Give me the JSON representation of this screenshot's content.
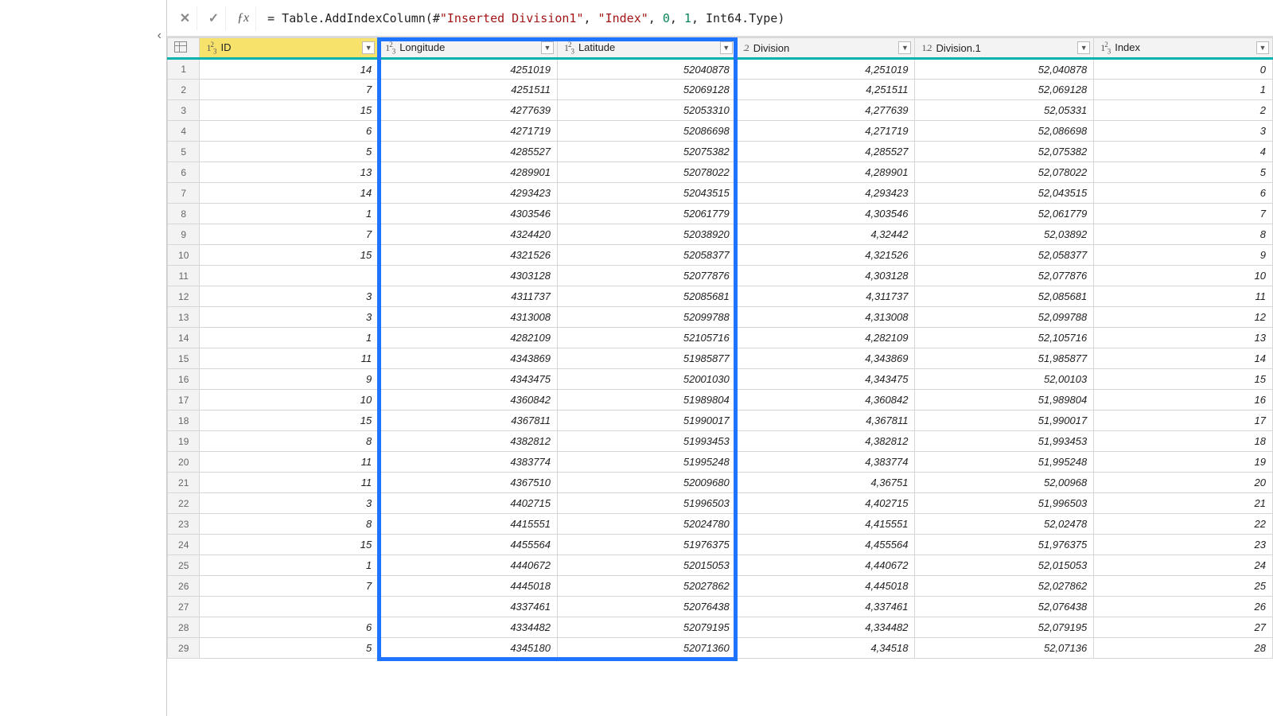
{
  "formula_raw": "= Table.AddIndexColumn(#\"Inserted Division1\", \"Index\", 0, 1, Int64.Type)",
  "columns": [
    {
      "key": "id",
      "name": "ID",
      "type": "123",
      "selected": true,
      "cls": "col-id",
      "dd": true
    },
    {
      "key": "lon",
      "name": "Longitude",
      "type": "123",
      "selected": false,
      "cls": "col-lon",
      "dd": true
    },
    {
      "key": "lat",
      "name": "Latitude",
      "type": "123",
      "selected": false,
      "cls": "col-lat",
      "dd": true
    },
    {
      "key": "div",
      "name": "Division",
      "type": "1.2",
      "selected": false,
      "cls": "col-div",
      "dd": true,
      "prefix": ".2"
    },
    {
      "key": "div1",
      "name": "Division.1",
      "type": "1.2",
      "selected": false,
      "cls": "col-div1",
      "dd": true
    },
    {
      "key": "idx",
      "name": "Index",
      "type": "123",
      "selected": false,
      "cls": "col-idx",
      "dd": true
    }
  ],
  "rows": [
    {
      "n": 1,
      "id": "14",
      "lon": "4251019",
      "lat": "52040878",
      "div": "4,251019",
      "div1": "52,040878",
      "idx": "0"
    },
    {
      "n": 2,
      "id": "7",
      "lon": "4251511",
      "lat": "52069128",
      "div": "4,251511",
      "div1": "52,069128",
      "idx": "1"
    },
    {
      "n": 3,
      "id": "15",
      "lon": "4277639",
      "lat": "52053310",
      "div": "4,277639",
      "div1": "52,05331",
      "idx": "2"
    },
    {
      "n": 4,
      "id": "6",
      "lon": "4271719",
      "lat": "52086698",
      "div": "4,271719",
      "div1": "52,086698",
      "idx": "3"
    },
    {
      "n": 5,
      "id": "5",
      "lon": "4285527",
      "lat": "52075382",
      "div": "4,285527",
      "div1": "52,075382",
      "idx": "4"
    },
    {
      "n": 6,
      "id": "13",
      "lon": "4289901",
      "lat": "52078022",
      "div": "4,289901",
      "div1": "52,078022",
      "idx": "5"
    },
    {
      "n": 7,
      "id": "14",
      "lon": "4293423",
      "lat": "52043515",
      "div": "4,293423",
      "div1": "52,043515",
      "idx": "6"
    },
    {
      "n": 8,
      "id": "1",
      "lon": "4303546",
      "lat": "52061779",
      "div": "4,303546",
      "div1": "52,061779",
      "idx": "7"
    },
    {
      "n": 9,
      "id": "7",
      "lon": "4324420",
      "lat": "52038920",
      "div": "4,32442",
      "div1": "52,03892",
      "idx": "8"
    },
    {
      "n": 10,
      "id": "15",
      "lon": "4321526",
      "lat": "52058377",
      "div": "4,321526",
      "div1": "52,058377",
      "idx": "9"
    },
    {
      "n": 11,
      "id": "",
      "lon": "4303128",
      "lat": "52077876",
      "div": "4,303128",
      "div1": "52,077876",
      "idx": "10"
    },
    {
      "n": 12,
      "id": "3",
      "lon": "4311737",
      "lat": "52085681",
      "div": "4,311737",
      "div1": "52,085681",
      "idx": "11"
    },
    {
      "n": 13,
      "id": "3",
      "lon": "4313008",
      "lat": "52099788",
      "div": "4,313008",
      "div1": "52,099788",
      "idx": "12"
    },
    {
      "n": 14,
      "id": "1",
      "lon": "4282109",
      "lat": "52105716",
      "div": "4,282109",
      "div1": "52,105716",
      "idx": "13"
    },
    {
      "n": 15,
      "id": "11",
      "lon": "4343869",
      "lat": "51985877",
      "div": "4,343869",
      "div1": "51,985877",
      "idx": "14"
    },
    {
      "n": 16,
      "id": "9",
      "lon": "4343475",
      "lat": "52001030",
      "div": "4,343475",
      "div1": "52,00103",
      "idx": "15"
    },
    {
      "n": 17,
      "id": "10",
      "lon": "4360842",
      "lat": "51989804",
      "div": "4,360842",
      "div1": "51,989804",
      "idx": "16"
    },
    {
      "n": 18,
      "id": "15",
      "lon": "4367811",
      "lat": "51990017",
      "div": "4,367811",
      "div1": "51,990017",
      "idx": "17"
    },
    {
      "n": 19,
      "id": "8",
      "lon": "4382812",
      "lat": "51993453",
      "div": "4,382812",
      "div1": "51,993453",
      "idx": "18"
    },
    {
      "n": 20,
      "id": "11",
      "lon": "4383774",
      "lat": "51995248",
      "div": "4,383774",
      "div1": "51,995248",
      "idx": "19"
    },
    {
      "n": 21,
      "id": "11",
      "lon": "4367510",
      "lat": "52009680",
      "div": "4,36751",
      "div1": "52,00968",
      "idx": "20"
    },
    {
      "n": 22,
      "id": "3",
      "lon": "4402715",
      "lat": "51996503",
      "div": "4,402715",
      "div1": "51,996503",
      "idx": "21"
    },
    {
      "n": 23,
      "id": "8",
      "lon": "4415551",
      "lat": "52024780",
      "div": "4,415551",
      "div1": "52,02478",
      "idx": "22"
    },
    {
      "n": 24,
      "id": "15",
      "lon": "4455564",
      "lat": "51976375",
      "div": "4,455564",
      "div1": "51,976375",
      "idx": "23"
    },
    {
      "n": 25,
      "id": "1",
      "lon": "4440672",
      "lat": "52015053",
      "div": "4,440672",
      "div1": "52,015053",
      "idx": "24"
    },
    {
      "n": 26,
      "id": "7",
      "lon": "4445018",
      "lat": "52027862",
      "div": "4,445018",
      "div1": "52,027862",
      "idx": "25"
    },
    {
      "n": 27,
      "id": "",
      "lon": "4337461",
      "lat": "52076438",
      "div": "4,337461",
      "div1": "52,076438",
      "idx": "26"
    },
    {
      "n": 28,
      "id": "6",
      "lon": "4334482",
      "lat": "52079195",
      "div": "4,334482",
      "div1": "52,079195",
      "idx": "27"
    },
    {
      "n": 29,
      "id": "5",
      "lon": "4345180",
      "lat": "52071360",
      "div": "4,34518",
      "div1": "52,07136",
      "idx": "28"
    }
  ],
  "highlight_cols": [
    "lon",
    "lat"
  ]
}
